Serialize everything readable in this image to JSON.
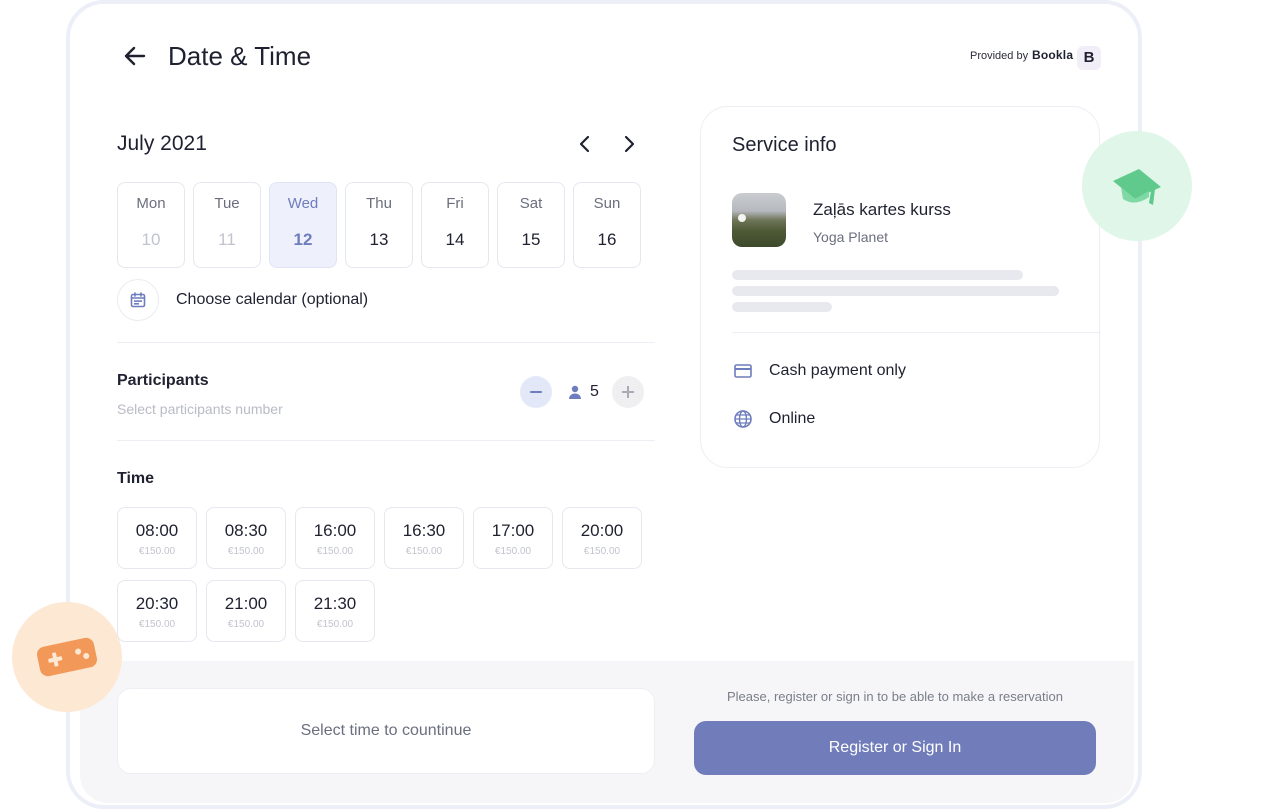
{
  "header": {
    "title": "Date & Time",
    "provided_by": "Provided by",
    "brand": "Bookla",
    "brand_logo": "B",
    "back_icon": "arrow-left-icon"
  },
  "calendar": {
    "month": "July 2021",
    "prev_icon": "chevron-left-icon",
    "next_icon": "chevron-right-icon",
    "days": [
      {
        "name": "Mon",
        "num": "10",
        "state": "disabled"
      },
      {
        "name": "Tue",
        "num": "11",
        "state": "disabled"
      },
      {
        "name": "Wed",
        "num": "12",
        "state": "selected"
      },
      {
        "name": "Thu",
        "num": "13",
        "state": "available"
      },
      {
        "name": "Fri",
        "num": "14",
        "state": "available"
      },
      {
        "name": "Sat",
        "num": "15",
        "state": "available"
      },
      {
        "name": "Sun",
        "num": "16",
        "state": "available"
      }
    ],
    "choose_calendar_label": "Choose calendar (optional)"
  },
  "participants": {
    "title": "Participants",
    "subtitle": "Select participants number",
    "count": "5"
  },
  "time": {
    "title": "Time",
    "slots": [
      {
        "time": "08:00",
        "price": "€150.00"
      },
      {
        "time": "08:30",
        "price": "€150.00"
      },
      {
        "time": "16:00",
        "price": "€150.00"
      },
      {
        "time": "16:30",
        "price": "€150.00"
      },
      {
        "time": "17:00",
        "price": "€150.00"
      },
      {
        "time": "20:00",
        "price": "€150.00"
      },
      {
        "time": "20:30",
        "price": "€150.00"
      },
      {
        "time": "21:00",
        "price": "€150.00"
      },
      {
        "time": "21:30",
        "price": "€150.00"
      }
    ]
  },
  "service": {
    "title": "Service info",
    "name": "Zaļās kartes kurss",
    "organization": "Yoga Planet",
    "payment": "Cash payment only",
    "location": "Online"
  },
  "footer": {
    "select_time_label": "Select time to countinue",
    "register_note": "Please, register or sign in to be able to make a reservation",
    "register_button": "Register or Sign In"
  },
  "colors": {
    "accent": "#717dba",
    "selected_bg": "#eef0fb",
    "cap_bubble": "#dff6e8",
    "cap_icon": "#5fca8c",
    "game_bubble": "#fde8d4",
    "game_icon": "#f2995a"
  }
}
